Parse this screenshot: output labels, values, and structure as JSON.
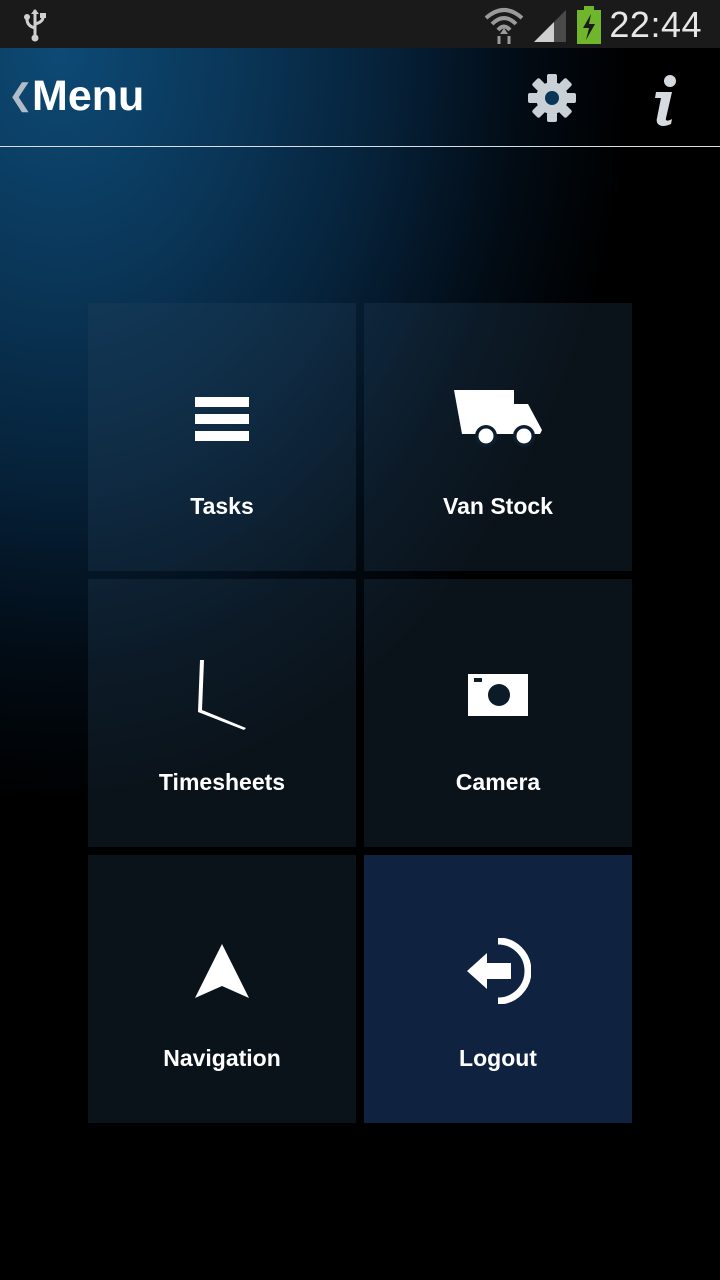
{
  "status_bar": {
    "time": "22:44",
    "icons": [
      "usb-icon",
      "wifi-icon",
      "signal-icon",
      "battery-charging-icon"
    ],
    "battery_color": "#6fb62c"
  },
  "app_bar": {
    "title": "Menu",
    "back_icon": "chevron-left-icon",
    "settings_icon": "gear-icon",
    "info_icon": "info-icon"
  },
  "menu": {
    "items": [
      {
        "label": "Tasks",
        "icon": "list-icon"
      },
      {
        "label": "Van Stock",
        "icon": "truck-icon"
      },
      {
        "label": "Timesheets",
        "icon": "clock-icon"
      },
      {
        "label": "Camera",
        "icon": "camera-icon"
      },
      {
        "label": "Navigation",
        "icon": "navigation-arrow-icon"
      },
      {
        "label": "Logout",
        "icon": "logout-icon"
      }
    ]
  },
  "colors": {
    "accent": "#0d4a75",
    "logout_tile": "#0f2240"
  }
}
